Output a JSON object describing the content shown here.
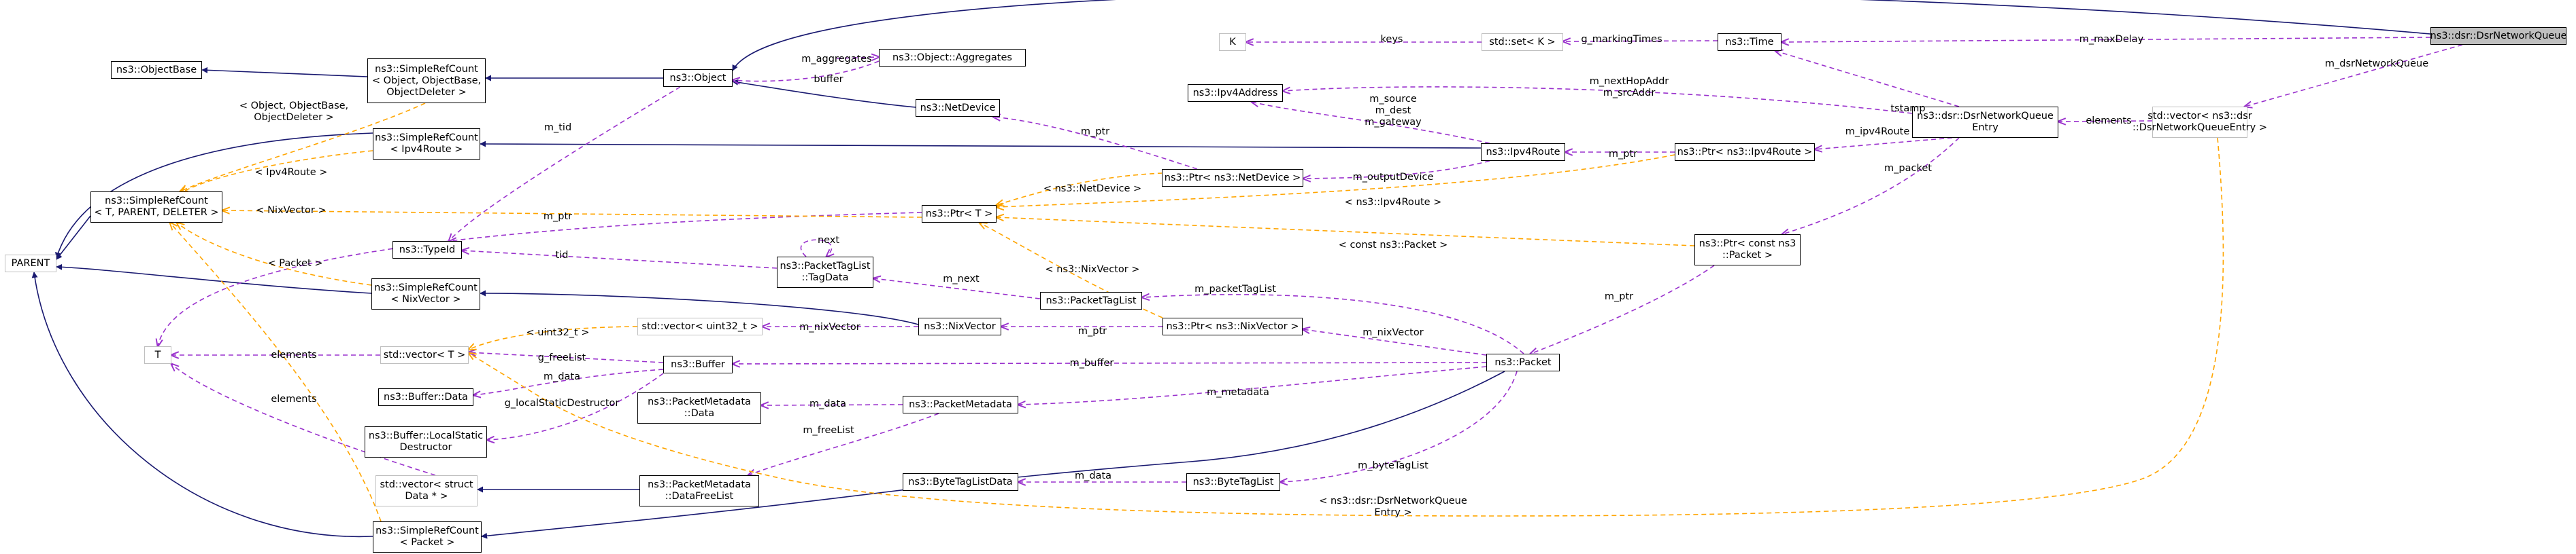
{
  "colors": {
    "inheritance": "#191970",
    "usage": "#9a32cd",
    "template": "#ffa500",
    "node_border": "#000000",
    "node_border_missing": "#bfbfbf",
    "focus_fill": "#bfbfbf"
  },
  "nodes": {
    "dsr_queue": [
      "ns3::dsr::DsrNetworkQueue"
    ],
    "time": [
      "ns3::Time"
    ],
    "set_k": [
      "std::set< K >"
    ],
    "k": [
      "K"
    ],
    "vector_entry": [
      "std::vector< ns3::dsr",
      "::DsrNetworkQueueEntry >"
    ],
    "queue_entry": [
      "ns3::dsr::DsrNetworkQueue",
      "Entry"
    ],
    "ipv4address": [
      "ns3::Ipv4Address"
    ],
    "ipv4route": [
      "ns3::Ipv4Route"
    ],
    "ptr_ipv4route": [
      "ns3::Ptr< ns3::Ipv4Route >"
    ],
    "ptr_const_packet": [
      "ns3::Ptr< const ns3",
      "::Packet >"
    ],
    "ptr_netdevice": [
      "ns3::Ptr< ns3::NetDevice >"
    ],
    "netdevice": [
      "ns3::NetDevice"
    ],
    "object": [
      "ns3::Object"
    ],
    "object_aggregates": [
      "ns3::Object::Aggregates"
    ],
    "simplerefcount_object": [
      "ns3::SimpleRefCount",
      "< Object, ObjectBase,",
      "ObjectDeleter >"
    ],
    "objectbase": [
      "ns3::ObjectBase"
    ],
    "simplerefcount_ipv4route": [
      "ns3::SimpleRefCount",
      "< Ipv4Route >"
    ],
    "simplerefcount_t": [
      "ns3::SimpleRefCount",
      "< T, PARENT, DELETER >"
    ],
    "parent": [
      "PARENT"
    ],
    "ptr_t": [
      "ns3::Ptr< T >"
    ],
    "typeid": [
      "ns3::TypeId"
    ],
    "packettaglist_tagdata": [
      "ns3::PacketTagList",
      "::TagData"
    ],
    "packettaglist": [
      "ns3::PacketTagList"
    ],
    "simplerefcount_nixvector": [
      "ns3::SimpleRefCount",
      "< NixVector >"
    ],
    "nixvector": [
      "ns3::NixVector"
    ],
    "ptr_nixvector": [
      "ns3::Ptr< ns3::NixVector >"
    ],
    "vector_uint32": [
      "std::vector< uint32_t >"
    ],
    "packet": [
      "ns3::Packet"
    ],
    "t": [
      "T"
    ],
    "vector_t": [
      "std::vector< T >"
    ],
    "buffer": [
      "ns3::Buffer"
    ],
    "buffer_data": [
      "ns3::Buffer::Data"
    ],
    "packetmetadata_data": [
      "ns3::PacketMetadata",
      "::Data"
    ],
    "packetmetadata": [
      "ns3::PacketMetadata"
    ],
    "buffer_localstatic": [
      "ns3::Buffer::LocalStatic",
      "Destructor"
    ],
    "vector_struct_data": [
      "std::vector< struct",
      "Data * >"
    ],
    "packetmetadata_datafreelist": [
      "ns3::PacketMetadata",
      "::DataFreeList"
    ],
    "bytetaglistdata": [
      "ns3::ByteTagListData"
    ],
    "bytetaglist": [
      "ns3::ByteTagList"
    ],
    "simplerefcount_packet": [
      "ns3::SimpleRefCount",
      "< Packet >"
    ]
  },
  "edge_labels": {
    "m_maxDelay": [
      "m_maxDelay"
    ],
    "m_dsrNetworkQueue": [
      "m_dsrNetworkQueue"
    ],
    "keys": [
      "keys"
    ],
    "g_markingTimes": [
      "g_markingTimes"
    ],
    "tstamp": [
      "tstamp"
    ],
    "elements_entry": [
      "elements"
    ],
    "m_nextHopAddr": [
      "m_nextHopAddr",
      "m_srcAddr"
    ],
    "m_source": [
      "m_source",
      "m_dest",
      "m_gateway"
    ],
    "m_ipv4Route": [
      "m_ipv4Route"
    ],
    "m_ptr_route": [
      "m_ptr"
    ],
    "m_packet": [
      "m_packet"
    ],
    "m_outputDevice": [
      "m_outputDevice"
    ],
    "m_ptr_netdevice": [
      "m_ptr"
    ],
    "t_netdevice": [
      "< ns3::NetDevice >"
    ],
    "t_ipv4route_ptr": [
      "< ns3::Ipv4Route >"
    ],
    "t_const_packet": [
      "< const ns3::Packet >"
    ],
    "m_ptr_packet": [
      "m_ptr"
    ],
    "m_aggregates": [
      "m_aggregates"
    ],
    "buffer_agg": [
      "buffer"
    ],
    "m_tid": [
      "m_tid"
    ],
    "t_object_base": [
      "< Object, ObjectBase,",
      "ObjectDeleter >"
    ],
    "t_ipv4route_src": [
      "< Ipv4Route >"
    ],
    "t_nixvector_src": [
      "< NixVector >"
    ],
    "t_packet_src": [
      "< Packet >"
    ],
    "m_ptr_t": [
      "m_ptr"
    ],
    "next": [
      "next"
    ],
    "tid": [
      "tid"
    ],
    "m_next": [
      "m_next"
    ],
    "m_packetTagList": [
      "m_packetTagList"
    ],
    "t_nixvector_ptr": [
      "< ns3::NixVector >"
    ],
    "m_nixVector_inner": [
      "m_nixVector"
    ],
    "m_ptr_nix": [
      "m_ptr"
    ],
    "m_nixVector": [
      "m_nixVector"
    ],
    "t_uint32": [
      "< uint32_t >"
    ],
    "elements_t": [
      "elements"
    ],
    "g_freeList": [
      "g_freeList"
    ],
    "m_buffer": [
      "m_buffer"
    ],
    "m_data_buffer": [
      "m_data"
    ],
    "g_localStatic": [
      "g_localStaticDestructor"
    ],
    "m_data_meta": [
      "m_data"
    ],
    "m_metadata": [
      "m_metadata"
    ],
    "m_freeList": [
      "m_freeList"
    ],
    "elements_struct": [
      "elements"
    ],
    "m_data_byte": [
      "m_data"
    ],
    "m_byteTagList": [
      "m_byteTagList"
    ],
    "t_dsr_entry": [
      "< ns3::dsr::DsrNetworkQueue",
      "Entry >"
    ]
  }
}
